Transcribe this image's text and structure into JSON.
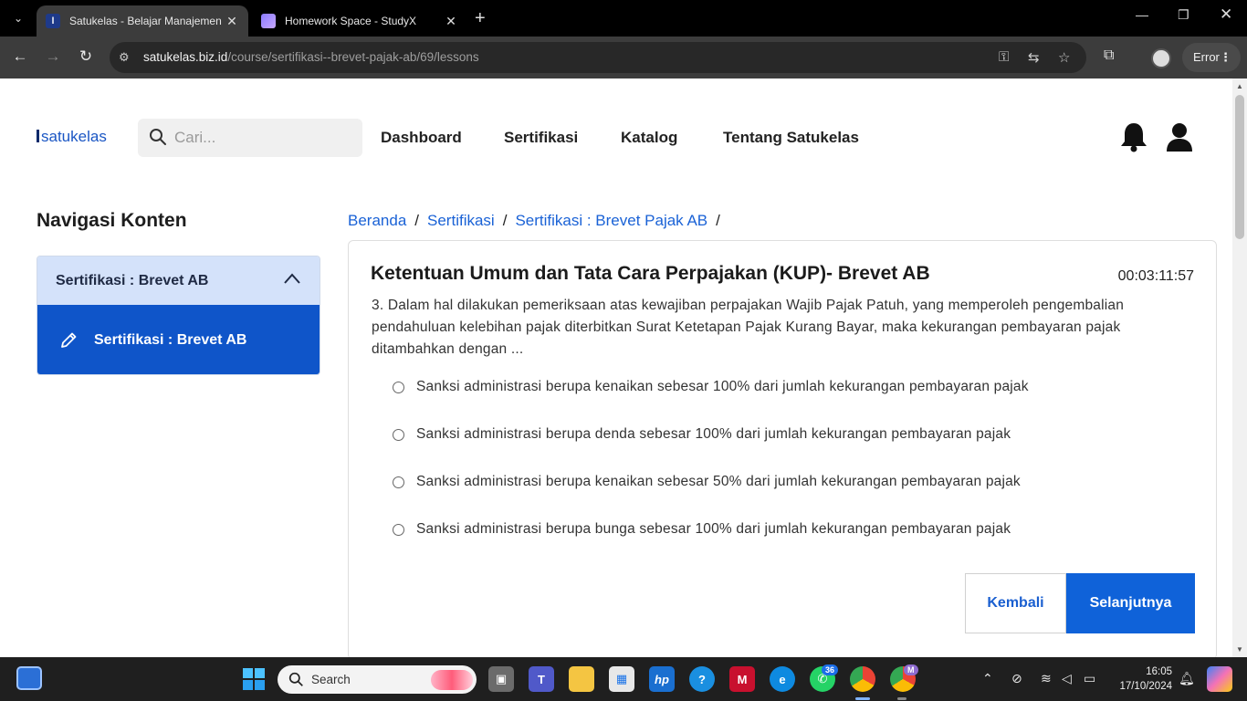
{
  "browser": {
    "tabs": [
      {
        "title": "Satukelas - Belajar Manajemen",
        "active": true
      },
      {
        "title": "Homework Space - StudyX",
        "active": false
      }
    ],
    "url_domain": "satukelas.biz.id",
    "url_path": "/course/sertifikasi--brevet-pajak-ab/69/lessons",
    "profile_status": "Error"
  },
  "header": {
    "logo": "satukelas",
    "search_placeholder": "Cari...",
    "nav": [
      "Dashboard",
      "Sertifikasi",
      "Katalog",
      "Tentang Satukelas"
    ]
  },
  "sidebar": {
    "title": "Navigasi Konten",
    "section": "Sertifikasi : Brevet AB",
    "items": [
      {
        "label": "Sertifikasi : Brevet AB",
        "icon": "pencil-icon"
      }
    ]
  },
  "breadcrumb": [
    "Beranda",
    "Sertifikasi",
    "Sertifikasi : Brevet Pajak AB"
  ],
  "quiz": {
    "title": "Ketentuan Umum dan Tata Cara Perpajakan (KUP)- Brevet AB",
    "timer": "00:03:11:57",
    "question": "3. Dalam hal dilakukan pemeriksaan atas kewajiban perpajakan Wajib Pajak Patuh, yang memperoleh pengembalian pendahuluan kelebihan pajak diterbitkan Surat Ketetapan Pajak Kurang Bayar, maka kekurangan pembayaran pajak ditambahkan dengan ...",
    "options": [
      "Sanksi administrasi berupa kenaikan sebesar 100% dari jumlah kekurangan pembayaran pajak",
      "Sanksi administrasi berupa denda sebesar 100% dari jumlah kekurangan pembayaran pajak",
      "Sanksi administrasi berupa kenaikan sebesar 50% dari jumlah kekurangan pembayaran pajak",
      "Sanksi administrasi berupa bunga sebesar 100% dari jumlah kekurangan pembayaran pajak"
    ],
    "back_label": "Kembali",
    "next_label": "Selanjutnya"
  },
  "taskbar": {
    "search_label": "Search",
    "whatsapp_badge": "36",
    "chrome_profile_badge": "M",
    "time": "16:05",
    "date": "17/10/2024"
  },
  "colors": {
    "brand_blue": "#0f62d9",
    "sidebar_active": "#0f55c9",
    "sidebar_header": "#d4e2fa",
    "link_blue": "#1a62d6"
  }
}
